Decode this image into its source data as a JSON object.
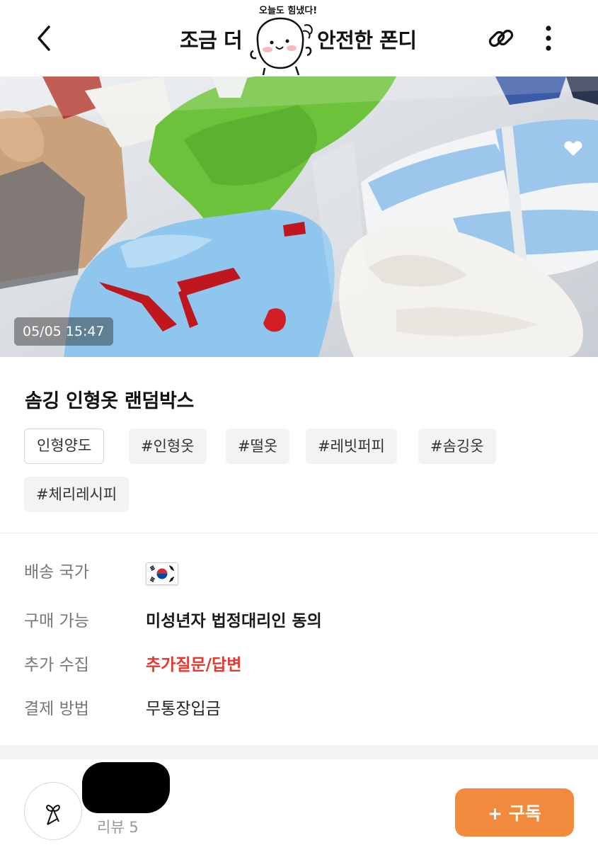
{
  "header": {
    "title_left": "조금 더",
    "title_right": "안전한 폰디",
    "sticker_text": "오늘도 힘냈다!",
    "icons": {
      "back": "chevron-left-icon",
      "link": "link-icon",
      "more": "more-vertical-icon"
    }
  },
  "hero": {
    "timestamp": "05/05 15:47"
  },
  "product": {
    "title": "솜깅 인형옷 랜덤박스",
    "tags": [
      "인형양도",
      "#인형옷",
      "#떨옷",
      "#레빗퍼피",
      "#솜깅옷",
      "#체리레시피"
    ]
  },
  "info": {
    "shipping_country": {
      "label": "배송 국가",
      "flag_icon": "korea-flag-icon"
    },
    "purchase": {
      "label": "구매 가능",
      "value": "미성년자 법정대리인 동의"
    },
    "extra": {
      "label": "추가 수집",
      "value": "추가질문/답변"
    },
    "payment": {
      "label": "결제 방법",
      "value": "무통장입금"
    }
  },
  "seller": {
    "reviews": "리뷰 5",
    "subscribe_label": "+ 구독",
    "avatar_icon": "bow-icon"
  },
  "colors": {
    "accent_orange": "#f28a3e",
    "highlight_red": "#e8372e",
    "tag_bg": "#f3f3f5"
  }
}
